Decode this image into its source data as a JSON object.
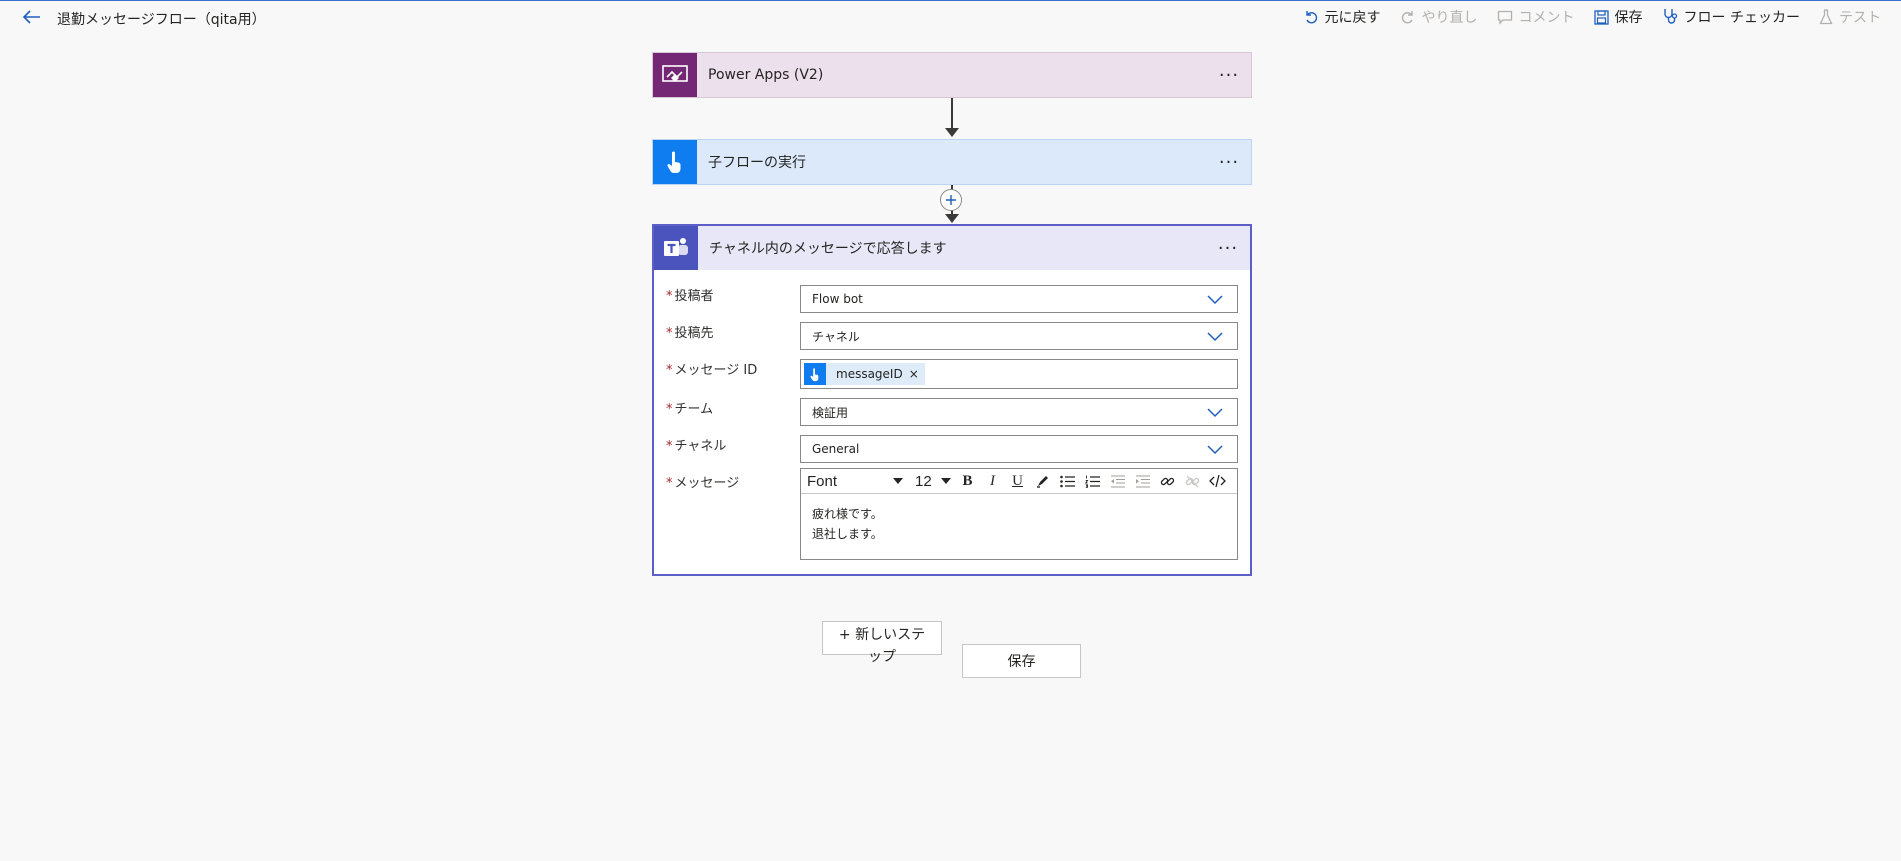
{
  "header": {
    "flow_title": "退勤メッセージフロー（qita用）",
    "actions": [
      {
        "label": "元に戻す",
        "icon": "undo-icon",
        "enabled": true
      },
      {
        "label": "やり直し",
        "icon": "redo-icon",
        "enabled": false
      },
      {
        "label": "コメント",
        "icon": "comment-icon",
        "enabled": false
      },
      {
        "label": "保存",
        "icon": "save-icon",
        "enabled": true
      },
      {
        "label": "フロー チェッカー",
        "icon": "stethoscope-icon",
        "enabled": true
      },
      {
        "label": "テスト",
        "icon": "flask-icon",
        "enabled": false
      }
    ]
  },
  "steps": {
    "trigger": {
      "title": "Power Apps (V2)",
      "more": "···"
    },
    "child_flow": {
      "title": "子フローの実行",
      "more": "···"
    },
    "reply": {
      "title": "チャネル内のメッセージで応答します",
      "more": "···",
      "required_mark": "*",
      "fields": {
        "poster": {
          "label": "投稿者",
          "value": "Flow bot"
        },
        "post_in": {
          "label": "投稿先",
          "value": "チャネル"
        },
        "message_id": {
          "label": "メッセージ ID",
          "token": "messageID",
          "token_remove": "×"
        },
        "team": {
          "label": "チーム",
          "value": "検証用"
        },
        "channel": {
          "label": "チャネル",
          "value": "General"
        },
        "message": {
          "label": "メッセージ",
          "font": "Font",
          "size": "12",
          "lines": [
            "疲れ様です。",
            "退社します。"
          ]
        }
      }
    }
  },
  "buttons": {
    "new_step": "+ 新しいステップ",
    "save": "保存"
  },
  "colors": {
    "power_apps": "#742774",
    "child_flow": "#0f7cf0",
    "teams": "#4b53bc",
    "accent": "#1f5fbf"
  }
}
